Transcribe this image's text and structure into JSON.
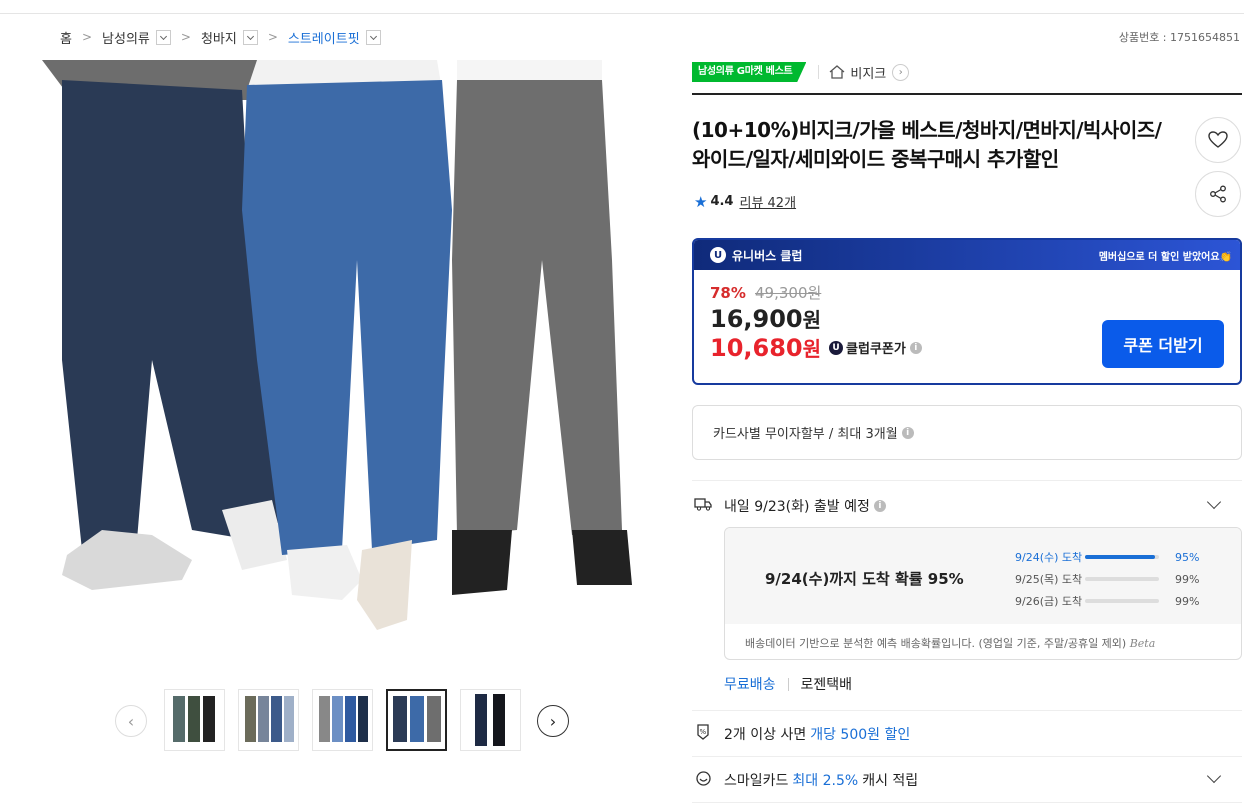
{
  "breadcrumb": {
    "home": "홈",
    "cat1": "남성의류",
    "cat2": "청바지",
    "cat3": "스트레이트핏"
  },
  "product_no": "상품번호 : 1751654851",
  "tags": {
    "best": "남성의류 G마켓 베스트",
    "shop": "비지크"
  },
  "title": "(10+10%)비지크/가을 베스트/청바지/면바지/빅사이즈/와이드/일자/세미와이드 중복구매시 추가할인",
  "rating": {
    "score": "4.4",
    "reviews": "리뷰 42개"
  },
  "club": {
    "name": "유니버스 클럽",
    "promo": "멤버십으로 더 할인 받았어요👏",
    "discount": "78%",
    "original": "49,300원",
    "price": "16,900",
    "price_unit": "원",
    "club_price": "10,680",
    "club_unit": "원",
    "club_label": "클럽쿠폰가",
    "coupon_button": "쿠폰 더받기"
  },
  "card_installment": "카드사별 무이자할부 / 최대 3개월",
  "shipping": {
    "depart": "내일 9/23(화) 출발 예정",
    "main": "9/24(수)까지 도착 확률 95%",
    "rows": [
      {
        "date": "9/24(수) 도착",
        "pct": "95%",
        "value": 95
      },
      {
        "date": "9/25(목) 도착",
        "pct": "99%",
        "value": 99
      },
      {
        "date": "9/26(금) 도착",
        "pct": "99%",
        "value": 99
      }
    ],
    "note": "배송데이터 기반으로 분석한 예측 배송확률입니다. (영업일 기준, 주말/공휴일 제외)",
    "beta": "Beta",
    "free": "무료배송",
    "courier": "로젠택배"
  },
  "promo1": {
    "prefix": "2개 이상 사면 ",
    "highlight": "개당 500원 할인"
  },
  "promo2": {
    "prefix": "스마일카드 ",
    "highlight": "최대 2.5%",
    "suffix": " 캐시 적립"
  },
  "colors": {
    "accent": "#1a6fd6",
    "club_border": "#163a9e",
    "sale_red": "#e8232c",
    "best_green": "#00b92f"
  }
}
